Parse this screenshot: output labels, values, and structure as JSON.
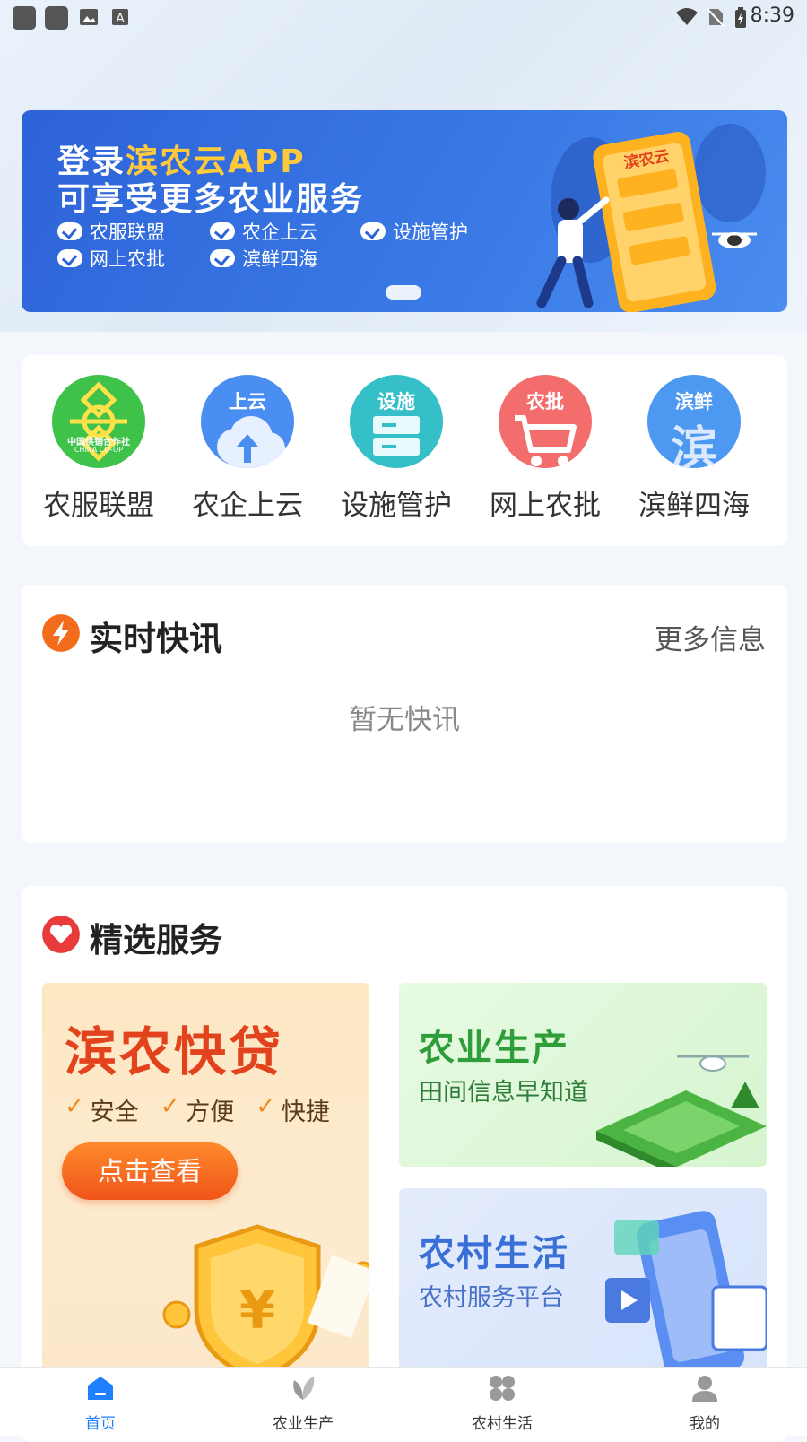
{
  "status_bar": {
    "time": "8:39"
  },
  "banner": {
    "line1_prefix": "登录",
    "line1_highlight": "滨农云APP",
    "line2": "可享受更多农业服务",
    "tags": [
      "农服联盟",
      "农企上云",
      "设施管护",
      "网上农批",
      "滨鲜四海"
    ],
    "phone_label": "滨农云"
  },
  "quick_services": [
    {
      "label": "农服联盟",
      "badge": "",
      "logo_text": "中国供销合作社",
      "logo_sub": "CHINA CO-OP",
      "color": "#3ec24a"
    },
    {
      "label": "农企上云",
      "badge": "上云",
      "color": "#4a8ef2"
    },
    {
      "label": "设施管护",
      "badge": "设施",
      "color": "#35bfc8"
    },
    {
      "label": "网上农批",
      "badge": "农批",
      "color": "#f36d6d"
    },
    {
      "label": "滨鲜四海",
      "badge": "滨鲜",
      "big_char": "滨",
      "color": "#4d98f0"
    }
  ],
  "news": {
    "title": "实时快讯",
    "more": "更多信息",
    "empty": "暂无快讯",
    "icon_color": "#f36c1c"
  },
  "featured": {
    "title": "精选服务",
    "icon_color": "#e93b3b",
    "loan": {
      "title": "滨农快贷",
      "features": [
        "安全",
        "方便",
        "快捷"
      ],
      "button": "点击查看",
      "currency": "¥"
    },
    "agri": {
      "title": "农业生产",
      "subtitle": "田间信息早知道"
    },
    "rural": {
      "title": "农村生活",
      "subtitle": "农村服务平台"
    }
  },
  "tabbar": [
    {
      "label": "首页",
      "active": true
    },
    {
      "label": "农业生产",
      "active": false
    },
    {
      "label": "农村生活",
      "active": false
    },
    {
      "label": "我的",
      "active": false
    }
  ],
  "colors": {
    "primary": "#1e80ff",
    "loan_red": "#e2421c",
    "agri_green": "#2f9d3a",
    "rural_blue": "#3a6fd8"
  }
}
